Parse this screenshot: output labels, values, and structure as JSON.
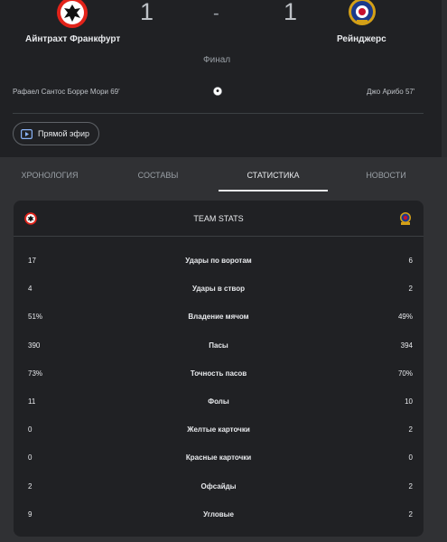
{
  "match": {
    "home": {
      "name": "Айнтрахт Франкфурт",
      "score": "1",
      "scorer": "Рафаел Сантос Борре Мори 69'"
    },
    "away": {
      "name": "Рейнджерс",
      "score": "1",
      "scorer": "Джо Арибо 57'"
    },
    "separator": "-",
    "status": "Финал"
  },
  "live_button": {
    "label": "Прямой эфир"
  },
  "tabs": [
    {
      "label": "ХРОНОЛОГИЯ"
    },
    {
      "label": "СОСТАВЫ"
    },
    {
      "label": "СТАТИСТИКА",
      "active": true
    },
    {
      "label": "НОВОСТИ"
    }
  ],
  "stats": {
    "title": "TEAM STATS",
    "rows": [
      {
        "home": "17",
        "label": "Удары по воротам",
        "away": "6"
      },
      {
        "home": "4",
        "label": "Удары в створ",
        "away": "2"
      },
      {
        "home": "51%",
        "label": "Владение мячом",
        "away": "49%"
      },
      {
        "home": "390",
        "label": "Пасы",
        "away": "394"
      },
      {
        "home": "73%",
        "label": "Точность пасов",
        "away": "70%"
      },
      {
        "home": "11",
        "label": "Фолы",
        "away": "10"
      },
      {
        "home": "0",
        "label": "Желтые карточки",
        "away": "2"
      },
      {
        "home": "0",
        "label": "Красные карточки",
        "away": "0"
      },
      {
        "home": "2",
        "label": "Офсайды",
        "away": "2"
      },
      {
        "home": "9",
        "label": "Угловые",
        "away": "2"
      }
    ]
  },
  "colors": {
    "background": "#202124",
    "panel": "#303134",
    "home_brand": "#e2231a",
    "away_brand": "#1b3a8c",
    "text": "#e8eaed",
    "muted": "#9aa0a6"
  }
}
